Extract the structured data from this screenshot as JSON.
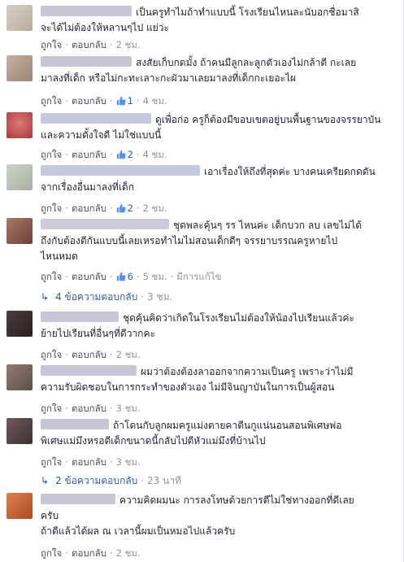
{
  "labels": {
    "like": "ถูกใจ",
    "reply": "ตอบกลับ",
    "dot": "·"
  },
  "comments": [
    {
      "line1": "เป็นครูทำไมถ้าทำแบบนี้ โรงเรียนไหนละนับอกชื่อมาสิ",
      "line2": "จะได้ไม่ต้องให้หลานๆไป แย่ว่ะ",
      "likes": "",
      "time": "2 ชม.",
      "edited": "",
      "avatar_color": "#c9c0b4",
      "name_color": "#c8c6d6"
    },
    {
      "line1": "สงสัยเก็บกดมั้ง ถ้าคนมีลูกละลูกตัวเองไม่กล้าตี กะเลย",
      "line2": "มาลงที่เด็ก หรือไม่กะทะเลาะกะผัวมาเลยมาลงที่เด็กกะเยอะไผ",
      "likes": "1",
      "time": "4 ชม.",
      "edited": "",
      "avatar_color": "#b39f8f",
      "name_color": "#c8c6d6"
    },
    {
      "line1": "ดูเพื่อก่อ ครูก็ต้องมีขอบเขตอยู่บนพื้นฐานของจรรยาบัน",
      "line2": "และความตั้งใจดี ไม่ใช่แบบนี้",
      "likes": "2",
      "time": "4 ชม.",
      "edited": "",
      "avatar_color": "#c05858",
      "name_color": "#c6c8dc"
    },
    {
      "line1": "เอาเรื่องให้ถึงที่สุดค่ะ บางคนเครียดกดดัน",
      "line2": "จากเรื่องอื่นมาลงที่เด็ก",
      "likes": "2",
      "time": "2 ชม.",
      "edited": "",
      "avatar_color": "#b7bfb2",
      "name_color": "#c6c8dc"
    },
    {
      "line1": "ชุดพละคุ้นๆ รร ไหนค่ะ เด็กบวก ลบ เลขไม่ได้",
      "line2": "ถึงกับต้องตีกันแบบนี้เลยเหรอทำไมไม่สอนเด็กดีๆ จรรยาบรรณครูหายไป",
      "line3": "ไหนหมด",
      "likes": "6",
      "time": "5 ชม.",
      "edited": "มีการแก้ไข",
      "avatar_color": "#8a5a4e",
      "name_color": "#ccccd8",
      "replies": "4 ข้อความตอบกลับ",
      "replies_time": "3 ชม."
    },
    {
      "line1": "ชุดคุ้นคิดว่าเกิดในโรงเรียนไม่ต้องให้น้องไปเรียนแล้วค่ะ",
      "line2": "ย้ายไปเรียนที่อื่นๆที่ดีวากคะ",
      "likes": "",
      "time": "2 ชม.",
      "edited": "",
      "avatar_color": "#3e3434",
      "name_color": "#c8c6d6"
    },
    {
      "line1": "ผมว่าต้องต้องลาออกจากความเป็นครู เพราะว่าไม่มี",
      "line2": "ความรับผิดชอบในการกระทำของตัวเอง ไม่มีจินญาบันในการเป็นผู้สอน",
      "likes": "",
      "time": "3 ชม.",
      "edited": "",
      "avatar_color": "#7a6a60",
      "name_color": "#c8c6d6"
    },
    {
      "line1": "ถ้าโดนกับลูกผมครูแม่งตายคาตีนกูแน่นอนสอนพิเศษพ่อ",
      "line2": "พิเศษแม่มึงหรอดีเด็กขนาดนี้กลับไปตีหัวแม่มึงที่บ้านไป",
      "likes": "",
      "time": "3 ชม.",
      "edited": "",
      "avatar_color": "#5a4a4c",
      "name_color": "#c8c6d6",
      "replies": "2 ข้อความตอบกลับ",
      "replies_time": "23 นาที"
    },
    {
      "line1": "ความคิดผมนะ การลงโทษด้วยการตีไม่ใช่ทางออกที่ดีเลย",
      "line2": "ครับ",
      "line3": "ถ้าตีแล้วได้ผล ณ เวลานี้ผมเป็นหมอไปแล้วครับ",
      "likes": "",
      "time": "2 ชม.",
      "edited": "",
      "avatar_color": "#c86a3a",
      "name_color": "#c8c6d6"
    }
  ]
}
